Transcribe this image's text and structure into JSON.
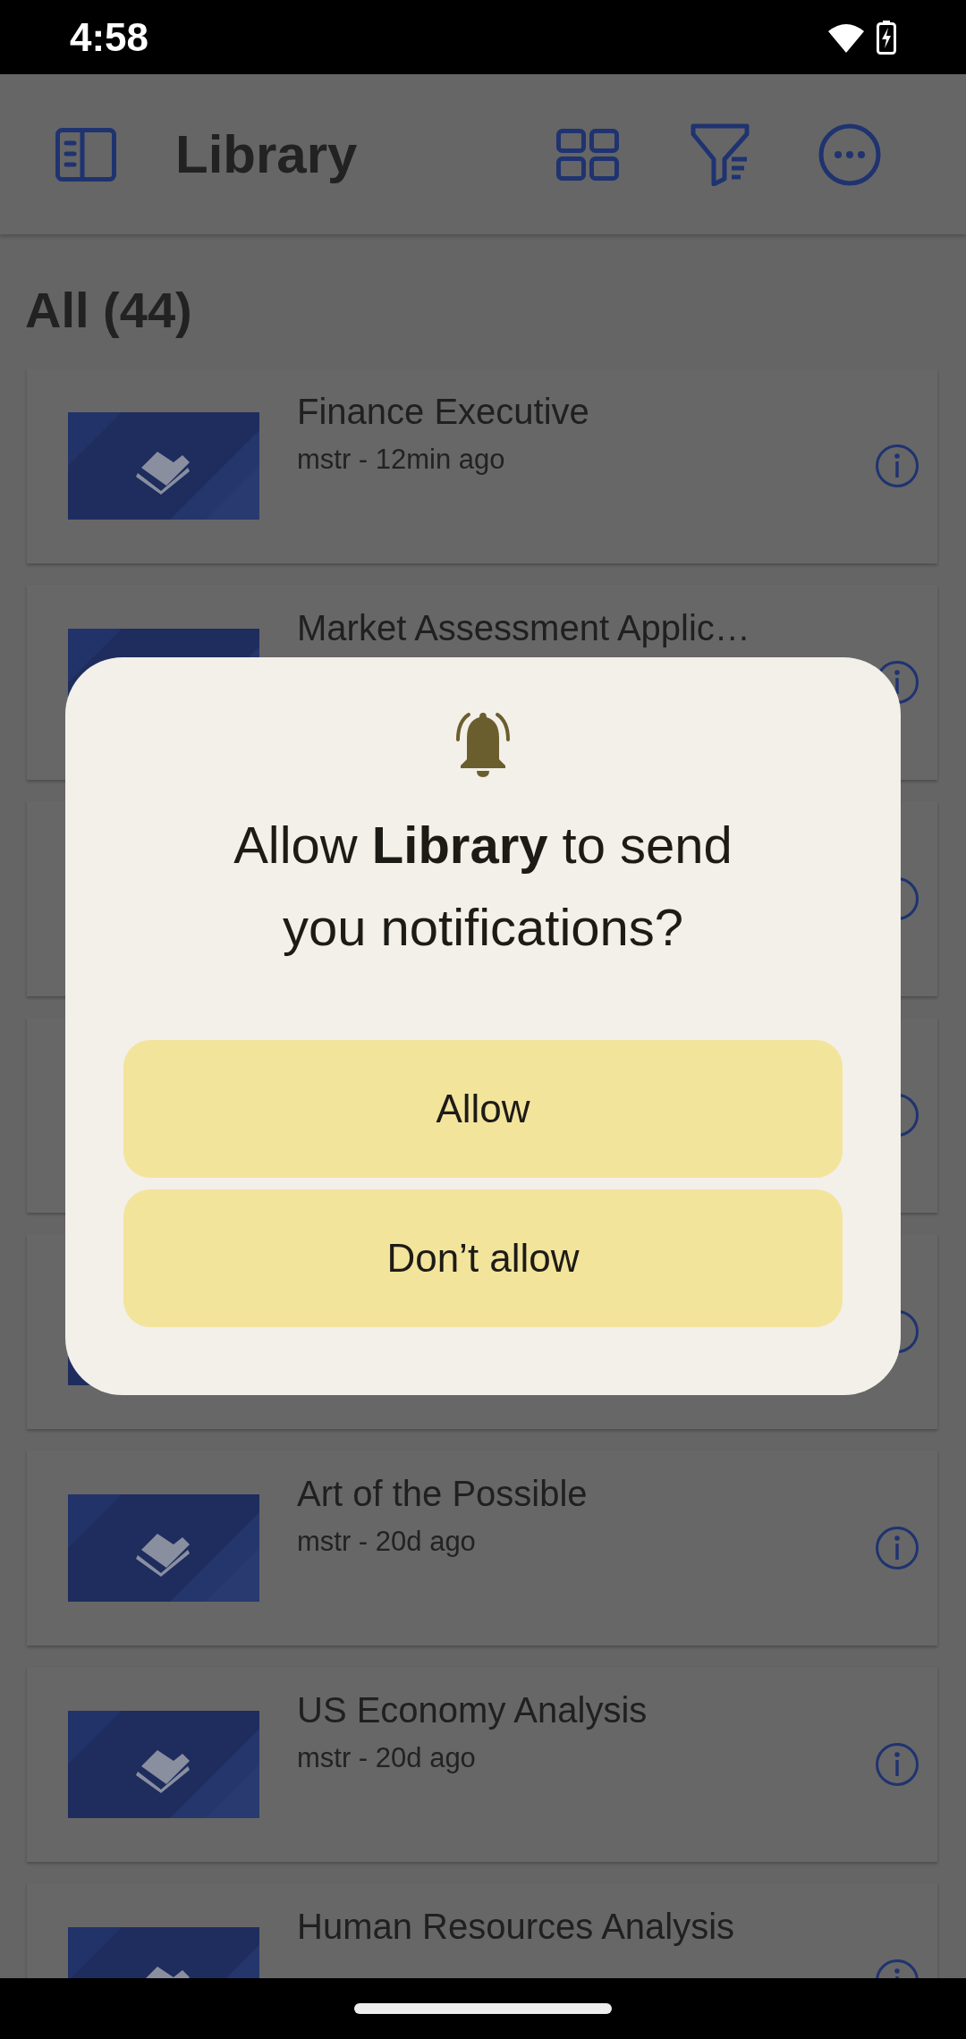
{
  "status_bar": {
    "time": "4:58"
  },
  "app_bar": {
    "title": "Library"
  },
  "section": {
    "title": "All (44)"
  },
  "items": [
    {
      "kind": "document",
      "thumbnail": true,
      "title": "Finance Executive",
      "subtitle": "mstr - 12min ago"
    },
    {
      "kind": "document",
      "thumbnail": true,
      "title": "Market Assessment Applic…"
    },
    {
      "kind": "document",
      "thumbnail": false
    },
    {
      "kind": "document",
      "thumbnail": false
    },
    {
      "kind": "document",
      "thumbnail": true
    },
    {
      "kind": "document",
      "thumbnail": true,
      "title": "Art of the Possible",
      "subtitle": "mstr - 20d ago"
    },
    {
      "kind": "document",
      "thumbnail": true,
      "title": "US Economy Analysis",
      "subtitle": "mstr - 20d ago"
    },
    {
      "kind": "document",
      "thumbnail": true,
      "title": "Human Resources Analysis"
    }
  ],
  "dialog": {
    "title": "Allow **Library** to send you notifications?",
    "buttons": [
      "Allow",
      "Don’t allow"
    ]
  }
}
